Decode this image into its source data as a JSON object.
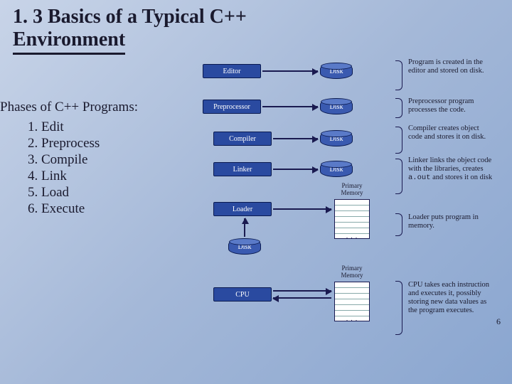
{
  "title_line1": "1. 3 Basics of a Typical C++",
  "title_line2": "Environment",
  "phases_heading": "Phases of C++ Programs:",
  "phases": [
    "Edit",
    "Preprocess",
    "Compile",
    "Link",
    "Load",
    "Execute"
  ],
  "boxes": {
    "editor": "Editor",
    "preprocessor": "Preprocessor",
    "compiler": "Compiler",
    "linker": "Linker",
    "loader": "Loader",
    "cpu": "CPU"
  },
  "disk_label": "Disk",
  "mem_label": "Primary\nMemory",
  "captions": {
    "editor": "Program is created in the editor and stored on disk.",
    "preprocessor": "Preprocessor program processes the code.",
    "compiler": "Compiler creates object code and stores it on disk.",
    "linker_pre": "Linker links the object code with the libraries, creates ",
    "linker_code": "a.out",
    "linker_post": " and stores it on disk",
    "loader": "Loader puts program in memory.",
    "cpu": "CPU takes each instruction and executes it, possibly storing new data values as the program executes."
  },
  "page_number": "6"
}
